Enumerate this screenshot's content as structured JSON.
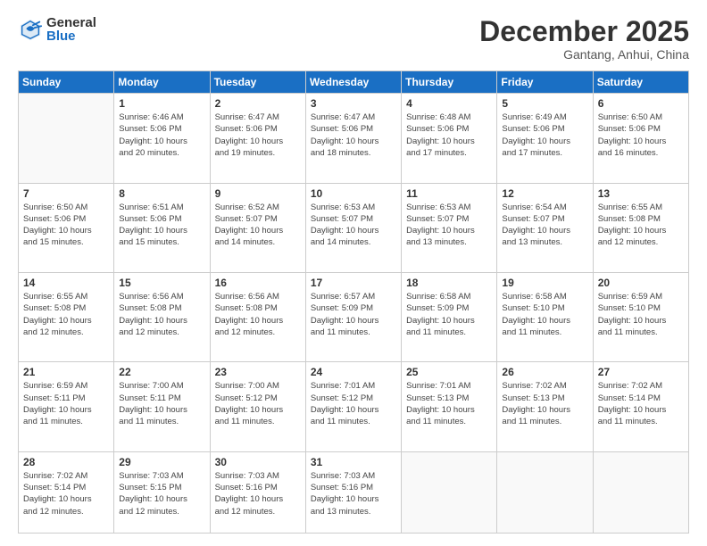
{
  "logo": {
    "general": "General",
    "blue": "Blue"
  },
  "title": "December 2025",
  "location": "Gantang, Anhui, China",
  "days_of_week": [
    "Sunday",
    "Monday",
    "Tuesday",
    "Wednesday",
    "Thursday",
    "Friday",
    "Saturday"
  ],
  "weeks": [
    [
      {
        "day": "",
        "info": ""
      },
      {
        "day": "1",
        "info": "Sunrise: 6:46 AM\nSunset: 5:06 PM\nDaylight: 10 hours\nand 20 minutes."
      },
      {
        "day": "2",
        "info": "Sunrise: 6:47 AM\nSunset: 5:06 PM\nDaylight: 10 hours\nand 19 minutes."
      },
      {
        "day": "3",
        "info": "Sunrise: 6:47 AM\nSunset: 5:06 PM\nDaylight: 10 hours\nand 18 minutes."
      },
      {
        "day": "4",
        "info": "Sunrise: 6:48 AM\nSunset: 5:06 PM\nDaylight: 10 hours\nand 17 minutes."
      },
      {
        "day": "5",
        "info": "Sunrise: 6:49 AM\nSunset: 5:06 PM\nDaylight: 10 hours\nand 17 minutes."
      },
      {
        "day": "6",
        "info": "Sunrise: 6:50 AM\nSunset: 5:06 PM\nDaylight: 10 hours\nand 16 minutes."
      }
    ],
    [
      {
        "day": "7",
        "info": "Sunrise: 6:50 AM\nSunset: 5:06 PM\nDaylight: 10 hours\nand 15 minutes."
      },
      {
        "day": "8",
        "info": "Sunrise: 6:51 AM\nSunset: 5:06 PM\nDaylight: 10 hours\nand 15 minutes."
      },
      {
        "day": "9",
        "info": "Sunrise: 6:52 AM\nSunset: 5:07 PM\nDaylight: 10 hours\nand 14 minutes."
      },
      {
        "day": "10",
        "info": "Sunrise: 6:53 AM\nSunset: 5:07 PM\nDaylight: 10 hours\nand 14 minutes."
      },
      {
        "day": "11",
        "info": "Sunrise: 6:53 AM\nSunset: 5:07 PM\nDaylight: 10 hours\nand 13 minutes."
      },
      {
        "day": "12",
        "info": "Sunrise: 6:54 AM\nSunset: 5:07 PM\nDaylight: 10 hours\nand 13 minutes."
      },
      {
        "day": "13",
        "info": "Sunrise: 6:55 AM\nSunset: 5:08 PM\nDaylight: 10 hours\nand 12 minutes."
      }
    ],
    [
      {
        "day": "14",
        "info": "Sunrise: 6:55 AM\nSunset: 5:08 PM\nDaylight: 10 hours\nand 12 minutes."
      },
      {
        "day": "15",
        "info": "Sunrise: 6:56 AM\nSunset: 5:08 PM\nDaylight: 10 hours\nand 12 minutes."
      },
      {
        "day": "16",
        "info": "Sunrise: 6:56 AM\nSunset: 5:08 PM\nDaylight: 10 hours\nand 12 minutes."
      },
      {
        "day": "17",
        "info": "Sunrise: 6:57 AM\nSunset: 5:09 PM\nDaylight: 10 hours\nand 11 minutes."
      },
      {
        "day": "18",
        "info": "Sunrise: 6:58 AM\nSunset: 5:09 PM\nDaylight: 10 hours\nand 11 minutes."
      },
      {
        "day": "19",
        "info": "Sunrise: 6:58 AM\nSunset: 5:10 PM\nDaylight: 10 hours\nand 11 minutes."
      },
      {
        "day": "20",
        "info": "Sunrise: 6:59 AM\nSunset: 5:10 PM\nDaylight: 10 hours\nand 11 minutes."
      }
    ],
    [
      {
        "day": "21",
        "info": "Sunrise: 6:59 AM\nSunset: 5:11 PM\nDaylight: 10 hours\nand 11 minutes."
      },
      {
        "day": "22",
        "info": "Sunrise: 7:00 AM\nSunset: 5:11 PM\nDaylight: 10 hours\nand 11 minutes."
      },
      {
        "day": "23",
        "info": "Sunrise: 7:00 AM\nSunset: 5:12 PM\nDaylight: 10 hours\nand 11 minutes."
      },
      {
        "day": "24",
        "info": "Sunrise: 7:01 AM\nSunset: 5:12 PM\nDaylight: 10 hours\nand 11 minutes."
      },
      {
        "day": "25",
        "info": "Sunrise: 7:01 AM\nSunset: 5:13 PM\nDaylight: 10 hours\nand 11 minutes."
      },
      {
        "day": "26",
        "info": "Sunrise: 7:02 AM\nSunset: 5:13 PM\nDaylight: 10 hours\nand 11 minutes."
      },
      {
        "day": "27",
        "info": "Sunrise: 7:02 AM\nSunset: 5:14 PM\nDaylight: 10 hours\nand 11 minutes."
      }
    ],
    [
      {
        "day": "28",
        "info": "Sunrise: 7:02 AM\nSunset: 5:14 PM\nDaylight: 10 hours\nand 12 minutes."
      },
      {
        "day": "29",
        "info": "Sunrise: 7:03 AM\nSunset: 5:15 PM\nDaylight: 10 hours\nand 12 minutes."
      },
      {
        "day": "30",
        "info": "Sunrise: 7:03 AM\nSunset: 5:16 PM\nDaylight: 10 hours\nand 12 minutes."
      },
      {
        "day": "31",
        "info": "Sunrise: 7:03 AM\nSunset: 5:16 PM\nDaylight: 10 hours\nand 13 minutes."
      },
      {
        "day": "",
        "info": ""
      },
      {
        "day": "",
        "info": ""
      },
      {
        "day": "",
        "info": ""
      }
    ]
  ]
}
